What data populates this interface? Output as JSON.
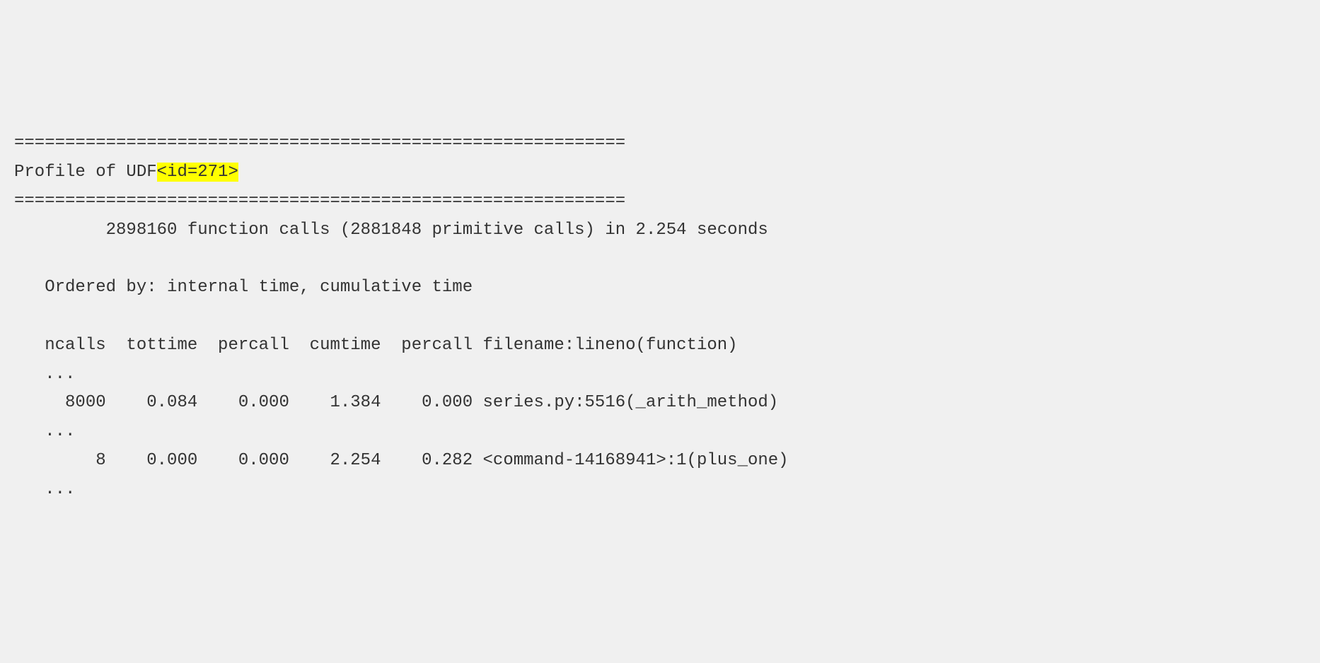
{
  "profile": {
    "separator": "============================================================",
    "title_prefix": "Profile of UDF",
    "title_id": "<id=271>",
    "summary": "         2898160 function calls (2881848 primitive calls) in 2.254 seconds",
    "ordered_by": "   Ordered by: internal time, cumulative time",
    "header": "   ncalls  tottime  percall  cumtime  percall filename:lineno(function)",
    "ellipsis": "   ...",
    "rows": [
      {
        "line": "     8000    0.084    0.000    1.384    0.000 series.py:5516(_arith_method)",
        "ncalls": "8000",
        "tottime": "0.084",
        "percall1": "0.000",
        "cumtime": "1.384",
        "percall2": "0.000",
        "location": "series.py:5516(_arith_method)"
      },
      {
        "line": "        8    0.000    0.000    2.254    0.282 <command-14168941>:1(plus_one)",
        "ncalls": "8",
        "tottime": "0.000",
        "percall1": "0.000",
        "cumtime": "2.254",
        "percall2": "0.282",
        "location": "<command-14168941>:1(plus_one)"
      }
    ]
  }
}
